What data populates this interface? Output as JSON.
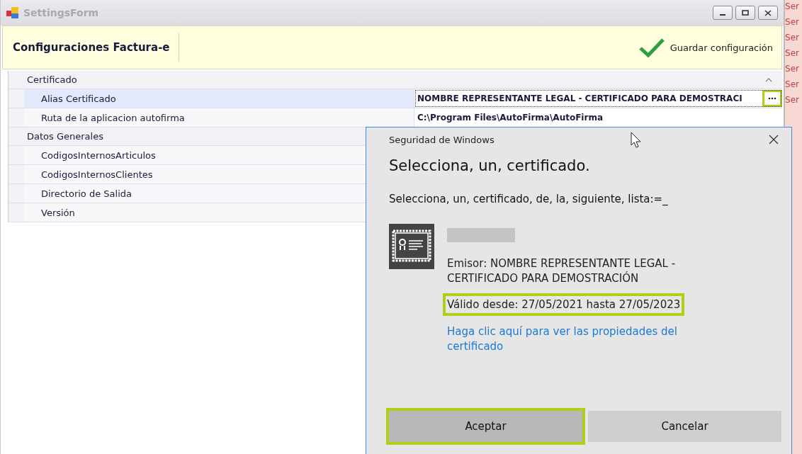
{
  "window": {
    "title": "SettingsForm"
  },
  "header": {
    "title": "Configuraciones Factura-e",
    "save_button": "Guardar configuración"
  },
  "property_grid": {
    "categories": [
      {
        "name": "Certificado",
        "expanded": true,
        "children": [
          {
            "name": "Alias Certificado",
            "value": "NOMBRE REPRESENTANTE LEGAL - CERTIFICADO PARA DEMOSTRACI",
            "selected": true,
            "has_button": true
          },
          {
            "name": "Ruta de la aplicacion autofirma",
            "value": "C:\\Program Files\\AutoFirma\\AutoFirma",
            "selected": false,
            "has_button": false
          }
        ]
      },
      {
        "name": "Datos Generales",
        "expanded": true,
        "children": [
          {
            "name": "CodigosInternosArticulos",
            "selected": false,
            "has_button": false
          },
          {
            "name": "CodigosInternosClientes",
            "selected": false,
            "has_button": false
          },
          {
            "name": "Directorio de Salida",
            "selected": false,
            "has_button": false
          },
          {
            "name": "Versión",
            "selected": false,
            "has_button": false
          }
        ]
      }
    ]
  },
  "background_window": {
    "cells": [
      "Ser",
      "Ser",
      "Ser",
      "Ser",
      "Ser",
      "Ser",
      "Ser"
    ]
  },
  "dialog": {
    "title": "Seguridad de Windows",
    "heading": "Selecciona, un, certificado.",
    "instruction": "Selecciona, un, certificado, de, la, siguiente, lista:=_",
    "issuer": "Emisor: NOMBRE REPRESENTANTE LEGAL - CERTIFICADO PARA DEMOSTRACIÓN",
    "validity": "Válido desde: 27/05/2021 hasta 27/05/2023",
    "link": "Haga clic aquí para ver las propiedades del certificado",
    "buttons": [
      {
        "label": "Aceptar",
        "highlighted": true
      },
      {
        "label": "Cancelar",
        "highlighted": false
      }
    ]
  }
}
